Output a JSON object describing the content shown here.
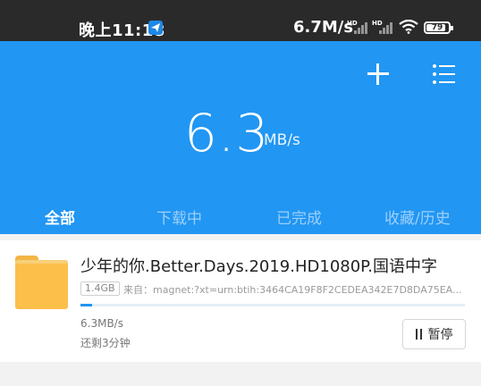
{
  "status_bar": {
    "time": "晚上11:18",
    "network_speed": "6.7M/s",
    "signal_1_label": "HD",
    "signal_2_label": "HD",
    "battery": "79"
  },
  "header": {
    "speed_value": "6.3",
    "speed_unit": "MB/s"
  },
  "tabs": [
    {
      "label": "全部"
    },
    {
      "label": "下载中"
    },
    {
      "label": "已完成"
    },
    {
      "label": "收藏/历史"
    }
  ],
  "download": {
    "name": "少年的你.Better.Days.2019.HD1080P.国语中字",
    "size": "1.4GB",
    "source": "来自：magnet:?xt=urn:btih:3464CA19F8F2CEDEA342E7D8DA75EA...",
    "progress": 0.03,
    "speed": "6.3MB/s",
    "time_left": "还剩3分钟",
    "pause_label": "暂停"
  },
  "colors": {
    "accent": "#2196f3",
    "status_bar": "#2a2a2a",
    "folder": "#fbbf4a"
  },
  "icons": {
    "app": "paper-plane-icon",
    "wifi": "wifi-icon",
    "add": "plus-icon",
    "menu": "list-menu-icon",
    "folder": "folder-icon",
    "pause": "pause-icon"
  }
}
